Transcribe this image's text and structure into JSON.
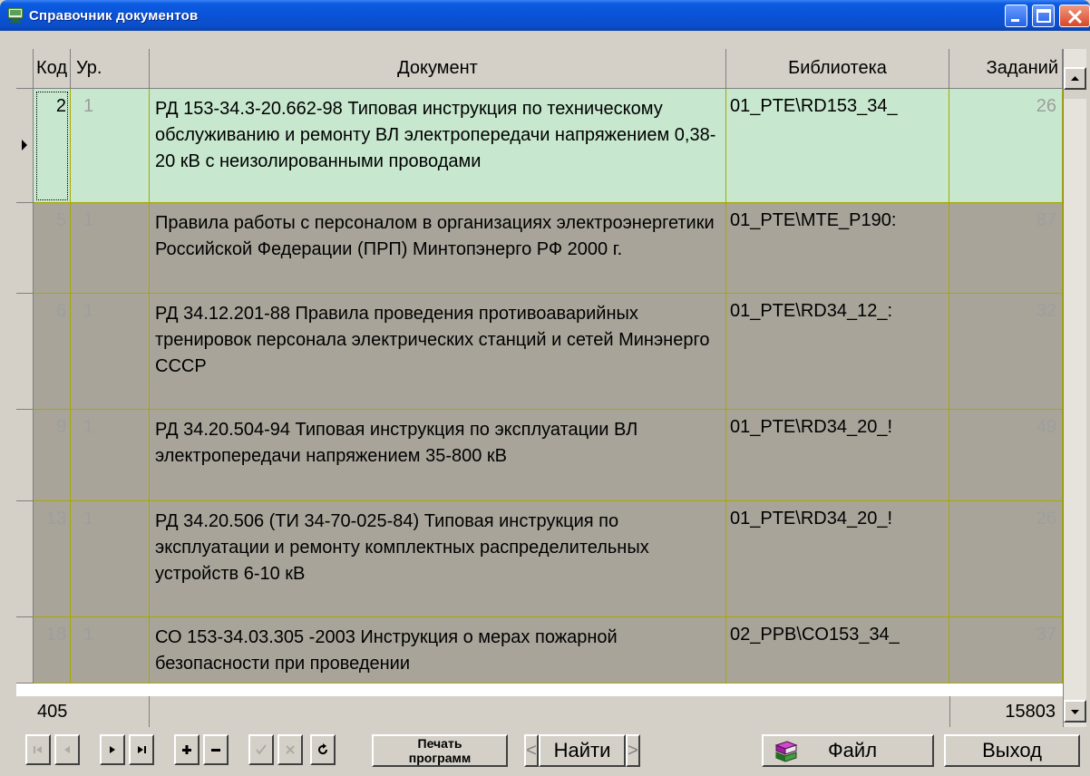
{
  "window": {
    "title": "Справочник документов"
  },
  "table": {
    "columns": {
      "kod": "Код",
      "ur": "Ур.",
      "document": "Документ",
      "library": "Библиотека",
      "tasks": "Заданий"
    },
    "rows": [
      {
        "kod": "2",
        "ur": "1",
        "document": "РД 153-34.3-20.662-98 Типовая инструкция по техническому обслуживанию и  ремонту ВЛ электропередачи напряжением 0,38-20 кВ с неизолированными проводами",
        "library": "01_PTE\\RD153_34_",
        "tasks": "26"
      },
      {
        "kod": "5",
        "ur": "1",
        "document": "Правила  работы с персоналом  в организациях электроэнергетики Российской Федерации (ПРП) Минтопэнерго РФ 2000 г.",
        "library": "01_PTE\\MTE_P190:",
        "tasks": "87"
      },
      {
        "kod": "6",
        "ur": "1",
        "document": "РД 34.12.201-88 Правила проведения противоаварийных тренировок персонала электрических станций  и  сетей Минэнерго СССР",
        "library": "01_PTE\\RD34_12_:",
        "tasks": "32"
      },
      {
        "kod": "9",
        "ur": "1",
        "document": "РД 34.20.504-94 Типовая инструкция по эксплуатации ВЛ электропередачи напряжением 35-800 кВ",
        "library": "01_PTE\\RD34_20_!",
        "tasks": "49"
      },
      {
        "kod": "13",
        "ur": "1",
        "document": "РД 34.20.506 (ТИ 34-70-025-84) Типовая инструкция по эксплуатации и ремонту комплектных распределительных устройств 6-10 кВ",
        "library": "01_PTE\\RD34_20_!",
        "tasks": "26"
      },
      {
        "kod": "18",
        "ur": "1",
        "document": "СО 153-34.03.305 -2003 Инструкция о мерах пожарной безопасности при проведении",
        "library": "02_PPB\\CO153_34_",
        "tasks": "37"
      }
    ],
    "footer": {
      "count": "405",
      "total": "15803"
    }
  },
  "toolbar": {
    "print_line1": "Печать",
    "print_line2": "программ",
    "search_label": "Найти",
    "search_prev": "<",
    "search_next": ">",
    "file_label": "Файл",
    "exit_label": "Выход"
  },
  "colors": {
    "selected_row": "#c7e8cf",
    "row": "#a8a49a",
    "titlebar": "#0a52d8",
    "grid_line": "#a8a800"
  }
}
